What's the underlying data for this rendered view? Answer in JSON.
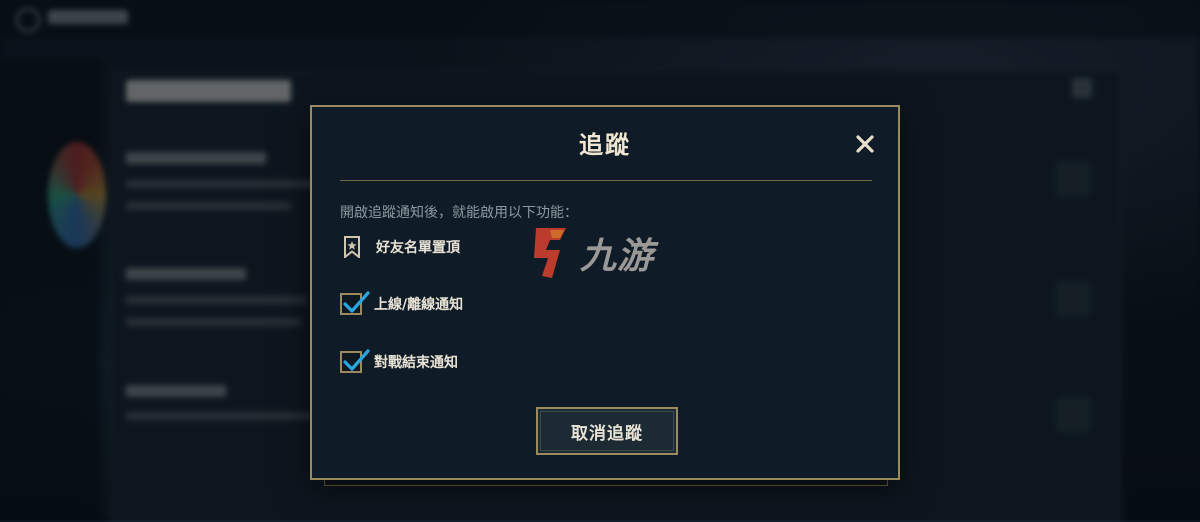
{
  "dialog": {
    "title": "追蹤",
    "intro": "開啟追蹤通知後，就能啟用以下功能：",
    "features": [
      {
        "label": "好友名單置頂",
        "icon": "bookmark-star-icon"
      },
      {
        "label": "上線/離線通知",
        "checked": true
      },
      {
        "label": "對戰結束通知",
        "checked": true
      }
    ],
    "cancel_label": "取消追蹤",
    "close_icon": "close-icon"
  },
  "watermark": {
    "text": "九游"
  },
  "colors": {
    "accent_gold": "#9c8a5f",
    "check_blue": "#2aa7e0",
    "title_text": "#f0e6d2",
    "dialog_bg": "#0f1b26"
  }
}
